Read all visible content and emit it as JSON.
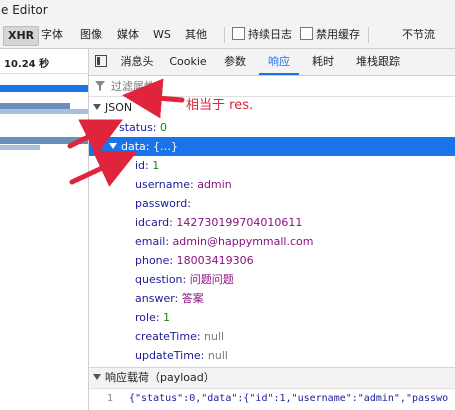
{
  "window": {
    "title": "e Editor"
  },
  "filterbar": {
    "items": [
      "XHR",
      "字体",
      "图像",
      "媒体",
      "WS",
      "其他"
    ],
    "active": "XHR",
    "persist_log": "持续日志",
    "disable_cache": "禁用缓存",
    "throttle": "不节流"
  },
  "requests": {
    "header": "10.24 秒"
  },
  "tabs": {
    "items": [
      "消息头",
      "Cookie",
      "参数",
      "响应",
      "耗时",
      "堆栈跟踪"
    ],
    "active": "响应"
  },
  "filter": {
    "placeholder": "过滤属性"
  },
  "tree": {
    "root": "JSON",
    "status_key": "status:",
    "status_val": "0",
    "data_key": "data:",
    "data_val": "{…}",
    "fields": [
      {
        "key": "id:",
        "val": "1",
        "kind": "num"
      },
      {
        "key": "username:",
        "val": "admin",
        "kind": "str"
      },
      {
        "key": "password:",
        "val": "",
        "kind": "str"
      },
      {
        "key": "idcard:",
        "val": "142730199704010611",
        "kind": "str"
      },
      {
        "key": "email:",
        "val": "admin@happymmall.com",
        "kind": "str"
      },
      {
        "key": "phone:",
        "val": "18003419306",
        "kind": "str"
      },
      {
        "key": "question:",
        "val": "问题问题",
        "kind": "str"
      },
      {
        "key": "answer:",
        "val": "答案",
        "kind": "str"
      },
      {
        "key": "role:",
        "val": "1",
        "kind": "num"
      },
      {
        "key": "createTime:",
        "val": "null",
        "kind": "nul"
      },
      {
        "key": "updateTime:",
        "val": "null",
        "kind": "nul"
      }
    ]
  },
  "annotation": {
    "text": "相当于 res."
  },
  "payload": {
    "header": "响应载荷（payload）",
    "line_no": "1",
    "text": "{\"status\":0,\"data\":{\"id\":1,\"username\":\"admin\",\"passwo"
  },
  "colors": {
    "accent": "#1a73e8",
    "annotation": "#e0243b"
  }
}
